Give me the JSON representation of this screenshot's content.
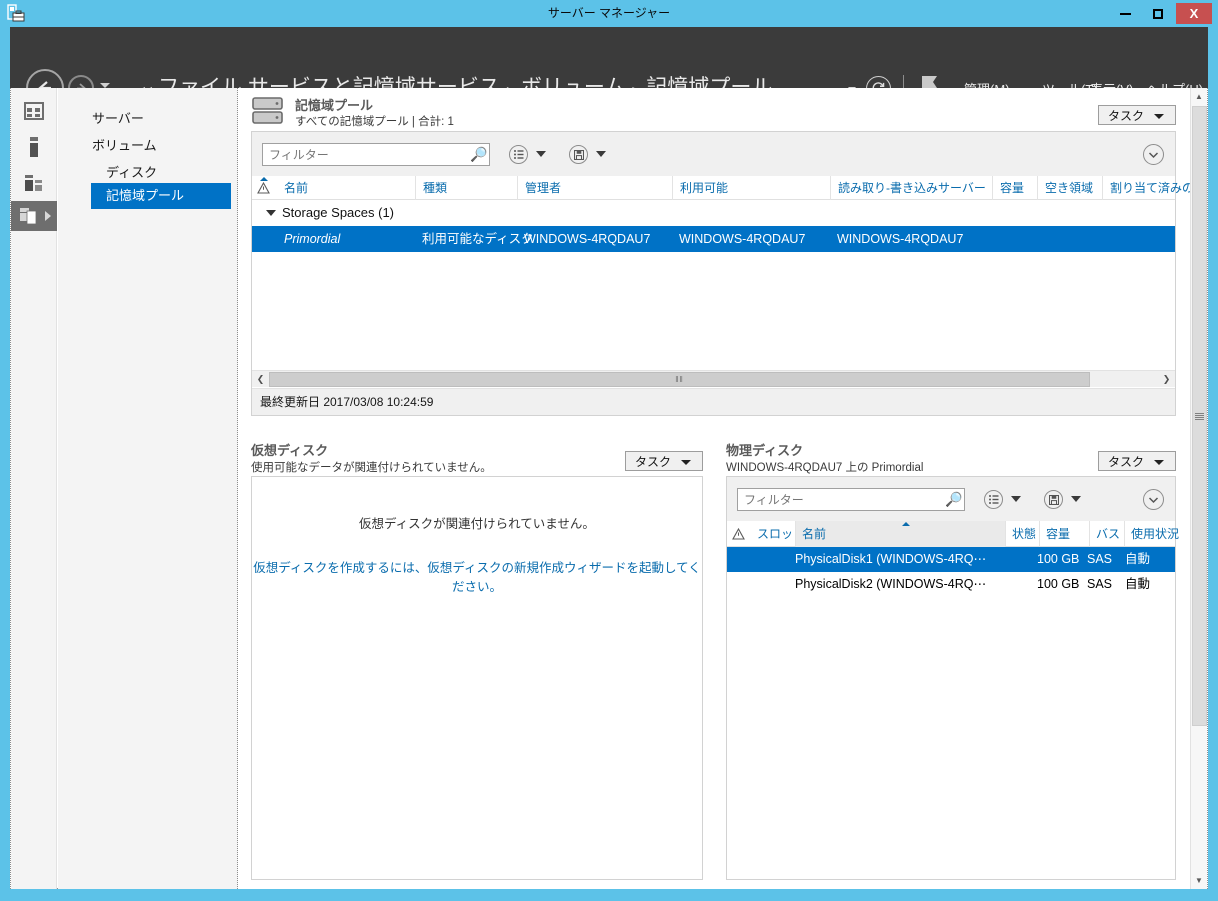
{
  "window": {
    "title": "サーバー マネージャー",
    "app_icon": "server-manager-icon",
    "minimize_label": "–",
    "maximize_label": "□",
    "close_label": "X",
    "titlebar_color": "#5cc2e8",
    "close_color": "#c75050"
  },
  "commandbar": {
    "back_icon": "back-arrow-icon",
    "forward_icon": "forward-arrow-icon",
    "dropdown_icon": "chevron-down-icon",
    "breadcrumb": {
      "prefix": "◂◂",
      "items": [
        "ファイル サービスと記憶域サービス",
        "ボリューム",
        "記憶域プール"
      ],
      "separator": "▸"
    },
    "refresh_icon": "refresh-icon",
    "flag_icon": "notification-flag-icon",
    "menus": [
      {
        "label": "管理",
        "accel": "M"
      },
      {
        "label": "ツール",
        "accel": "T"
      },
      {
        "label": "表示",
        "accel": "V"
      },
      {
        "label": "ヘルプ",
        "accel": "H"
      }
    ],
    "accent_color": "#3b3b3b"
  },
  "sidebar": {
    "rail_icons": [
      "dashboard-icon",
      "local-server-icon",
      "all-servers-icon",
      "file-storage-services-icon"
    ],
    "expand_icon": "chevron-right-icon",
    "items": [
      {
        "label": "サーバー",
        "selected": false
      },
      {
        "label": "ボリューム",
        "selected": false
      },
      {
        "label": "ディスク",
        "selected": false
      },
      {
        "label": "記憶域プール",
        "selected": true
      }
    ],
    "selected_color": "#0072c6"
  },
  "storage_pools": {
    "icon": "storage-pool-icon",
    "title": "記憶域プール",
    "subtitle": "すべての記憶域プール | 合計: 1",
    "tasks_label": "タスク",
    "filter": {
      "value": "",
      "placeholder": "フィルター",
      "icon": "search-icon"
    },
    "view_icon": "view-options-icon",
    "save_icon": "save-query-icon",
    "expand_icon": "chevron-down-circle-icon",
    "columns": [
      {
        "label": "",
        "name": "warning"
      },
      {
        "label": "名前",
        "name": "name"
      },
      {
        "label": "種類",
        "name": "type"
      },
      {
        "label": "管理者",
        "name": "managed-by"
      },
      {
        "label": "利用可能",
        "name": "available-to"
      },
      {
        "label": "読み取り-書き込みサーバー",
        "name": "read-write-server"
      },
      {
        "label": "容量",
        "name": "capacity"
      },
      {
        "label": "空き領域",
        "name": "free-space"
      },
      {
        "label": "割り当て済みの",
        "name": "allocated"
      }
    ],
    "group": {
      "label": "Storage Spaces (1)",
      "expanded": true
    },
    "rows": [
      {
        "name": "Primordial",
        "type": "利用可能なディスク",
        "managed_by": "WINDOWS-4RQDAU7",
        "available_to": "WINDOWS-4RQDAU7",
        "read_write_server": "WINDOWS-4RQDAU7",
        "capacity": "",
        "free_space": "",
        "allocated": "",
        "selected": true
      }
    ],
    "status": "最終更新日 2017/03/08 10:24:59",
    "hscroll": {
      "left_icon": "scroll-left-icon",
      "right_icon": "scroll-right-icon",
      "grip": "‖‖"
    }
  },
  "virtual_disks": {
    "title": "仮想ディスク",
    "subtitle": "使用可能なデータが関連付けられていません。",
    "tasks_label": "タスク",
    "empty_message": "仮想ディスクが関連付けられていません。",
    "link_message": "仮想ディスクを作成するには、仮想ディスクの新規作成ウィザードを起動してください。",
    "link_color": "#0a6cad"
  },
  "physical_disks": {
    "title": "物理ディスク",
    "subtitle": "WINDOWS-4RQDAU7 上の Primordial",
    "tasks_label": "タスク",
    "filter": {
      "value": "",
      "placeholder": "フィルター",
      "icon": "search-icon"
    },
    "view_icon": "view-options-icon",
    "save_icon": "save-query-icon",
    "expand_icon": "chevron-down-circle-icon",
    "columns": [
      {
        "label": "",
        "name": "warning"
      },
      {
        "label": "スロット",
        "name": "slot"
      },
      {
        "label": "名前",
        "name": "name",
        "sorted": true
      },
      {
        "label": "状態",
        "name": "status"
      },
      {
        "label": "容量",
        "name": "capacity"
      },
      {
        "label": "バス",
        "name": "bus"
      },
      {
        "label": "使用状況",
        "name": "usage"
      }
    ],
    "rows": [
      {
        "slot": "",
        "name": "PhysicalDisk1 (WINDOWS-4RQ⋯",
        "status": "",
        "capacity": "100 GB",
        "bus": "SAS",
        "usage": "自動",
        "selected": true
      },
      {
        "slot": "",
        "name": "PhysicalDisk2 (WINDOWS-4RQ⋯",
        "status": "",
        "capacity": "100 GB",
        "bus": "SAS",
        "usage": "自動",
        "selected": false
      }
    ]
  },
  "vscroll": {
    "up_icon": "scroll-up-icon",
    "down_icon": "scroll-down-icon"
  }
}
